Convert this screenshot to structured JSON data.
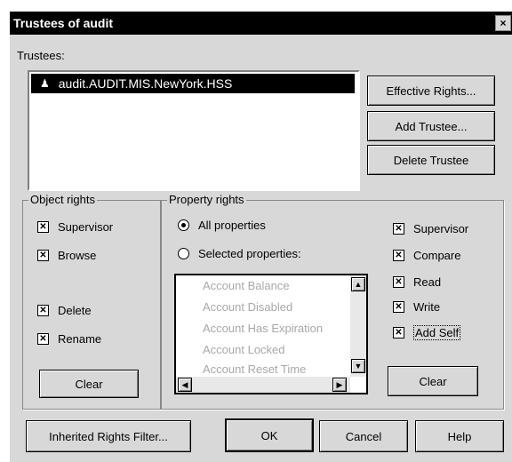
{
  "window": {
    "title": "Trustees of audit",
    "close_glyph": "×"
  },
  "trustees": {
    "label": "Trustees:",
    "items": [
      "audit.AUDIT.MIS.NewYork.HSS"
    ]
  },
  "buttons": {
    "effective_rights": "Effective Rights...",
    "add_trustee": "Add Trustee...",
    "delete_trustee": "Delete Trustee",
    "clear_object": "Clear",
    "clear_property": "Clear",
    "inherited_rights_filter": "Inherited Rights Filter...",
    "ok": "OK",
    "cancel": "Cancel",
    "help": "Help"
  },
  "object_rights": {
    "title": "Object rights",
    "supervisor": "Supervisor",
    "browse": "Browse",
    "delete": "Delete",
    "rename": "Rename"
  },
  "property_rights": {
    "title": "Property rights",
    "all_properties": "All properties",
    "selected_properties": "Selected properties:",
    "list": [
      "Account Balance",
      "Account Disabled",
      "Account Has Expiration",
      "Account Locked",
      "Account Reset Time"
    ],
    "supervisor": "Supervisor",
    "compare": "Compare",
    "read": "Read",
    "write": "Write",
    "add_self": "Add Self"
  },
  "checkmark": "✕",
  "scroll": {
    "up": "▲",
    "down": "▼",
    "left": "◀",
    "right": "▶"
  }
}
